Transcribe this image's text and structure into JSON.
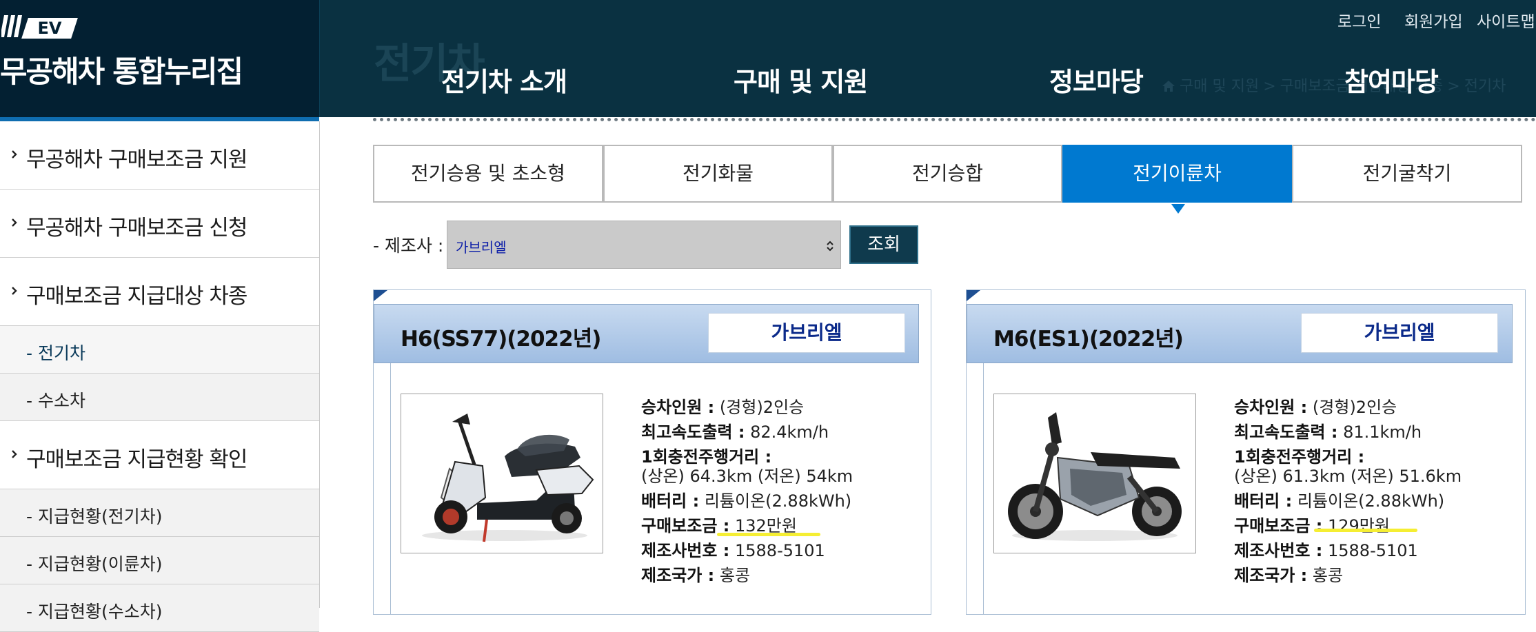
{
  "header": {
    "logo_badge": "EV",
    "logo_title": "무공해차 통합누리집",
    "ghost_title": "전기차",
    "util_links": [
      "로그인",
      "회원가입",
      "사이트맵"
    ],
    "gnb": [
      "전기차 소개",
      "구매 및 지원",
      "정보마당",
      "참여마당"
    ],
    "breadcrumb": [
      "구매 및 지원",
      "구매보조금 지급대상 차종",
      "전기차"
    ]
  },
  "sidebar": {
    "items": [
      {
        "label": "무공해차 구매보조금 지원",
        "level": "main"
      },
      {
        "label": "무공해차 구매보조금 신청",
        "level": "main"
      },
      {
        "label": "구매보조금 지급대상 차종",
        "level": "main"
      },
      {
        "label": "- 전기차",
        "level": "sub",
        "active": true
      },
      {
        "label": "- 수소차",
        "level": "sub"
      },
      {
        "label": "구매보조금 지급현황 확인",
        "level": "main"
      },
      {
        "label": "- 지급현황(전기차)",
        "level": "sub"
      },
      {
        "label": "- 지급현황(이륜차)",
        "level": "sub"
      },
      {
        "label": "- 지급현황(수소차)",
        "level": "sub"
      }
    ]
  },
  "tabs": [
    {
      "label": "전기승용 및 초소형"
    },
    {
      "label": "전기화물"
    },
    {
      "label": "전기승합"
    },
    {
      "label": "전기이륜차",
      "active": true
    },
    {
      "label": "전기굴착기"
    }
  ],
  "filter": {
    "label": "- 제조사 :",
    "selected": "가브리엘",
    "search_button": "조회"
  },
  "spec_labels": {
    "seats": "승차인원 :",
    "speed": "최고속도출력 :",
    "range": "1회충전주행거리 :",
    "battery": "배터리 :",
    "subsidy": "구매보조금 :",
    "phone": "제조사번호 :",
    "country": "제조국가 :"
  },
  "cards": [
    {
      "name": "H6(SS77)(2022년)",
      "maker": "가브리엘",
      "photo_icon": "scooter-photo",
      "seats": "(경형)2인승",
      "speed": "82.4km/h",
      "range": "(상온) 64.3km (저온) 54km",
      "battery": "리튬이온(2.88kWh)",
      "subsidy": "132만원",
      "phone": "1588-5101",
      "country": "홍콩"
    },
    {
      "name": "M6(ES1)(2022년)",
      "maker": "가브리엘",
      "photo_icon": "motorcycle-photo",
      "seats": "(경형)2인승",
      "speed": "81.1km/h",
      "range": "(상온) 61.3km (저온) 51.6km",
      "battery": "리튬이온(2.88kWh)",
      "subsidy": "129만원",
      "phone": "1588-5101",
      "country": "홍콩"
    }
  ],
  "colors": {
    "header_bg": "#0a3141",
    "logo_bg": "#032032",
    "tab_active": "#0079d0",
    "button_bg": "#0f3a4d",
    "highlight": "#f5ee33"
  }
}
